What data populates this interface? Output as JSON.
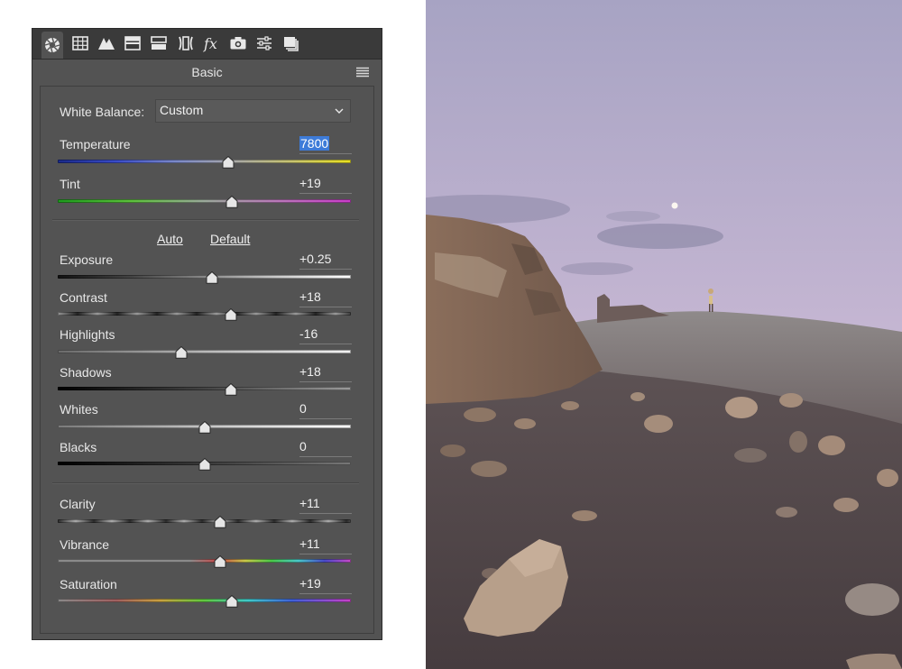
{
  "tabs": [
    {
      "icon": "aperture-icon",
      "active": true
    },
    {
      "icon": "tone-curve-grid-icon",
      "active": false
    },
    {
      "icon": "detail-mountains-icon",
      "active": false
    },
    {
      "icon": "hsl-icon",
      "active": false
    },
    {
      "icon": "split-toning-icon",
      "active": false
    },
    {
      "icon": "lens-corrections-icon",
      "active": false
    },
    {
      "icon": "fx-effects-icon",
      "active": false
    },
    {
      "icon": "camera-calibration-icon",
      "active": false
    },
    {
      "icon": "presets-sliders-icon",
      "active": false
    },
    {
      "icon": "snapshots-icon",
      "active": false
    }
  ],
  "panel": {
    "title": "Basic",
    "white_balance_label": "White Balance:",
    "white_balance_value": "Custom",
    "auto_label": "Auto",
    "default_label": "Default"
  },
  "sliders": {
    "temperature": {
      "label": "Temperature",
      "value": "7800",
      "position": 0.58
    },
    "tint": {
      "label": "Tint",
      "value": "+19",
      "position": 0.595
    },
    "exposure": {
      "label": "Exposure",
      "value": "+0.25",
      "position": 0.525
    },
    "contrast": {
      "label": "Contrast",
      "value": "+18",
      "position": 0.59
    },
    "highlights": {
      "label": "Highlights",
      "value": "-16",
      "position": 0.42
    },
    "shadows": {
      "label": "Shadows",
      "value": "+18",
      "position": 0.59
    },
    "whites": {
      "label": "Whites",
      "value": "0",
      "position": 0.5
    },
    "blacks": {
      "label": "Blacks",
      "value": "0",
      "position": 0.5
    },
    "clarity": {
      "label": "Clarity",
      "value": "+11",
      "position": 0.555
    },
    "vibrance": {
      "label": "Vibrance",
      "value": "+11",
      "position": 0.555
    },
    "saturation": {
      "label": "Saturation",
      "value": "+19",
      "position": 0.595
    }
  },
  "colors": {
    "selection_highlight": "#3d7bd8",
    "panel_bg": "#535353",
    "tabbar_bg": "#3a3a3a"
  }
}
